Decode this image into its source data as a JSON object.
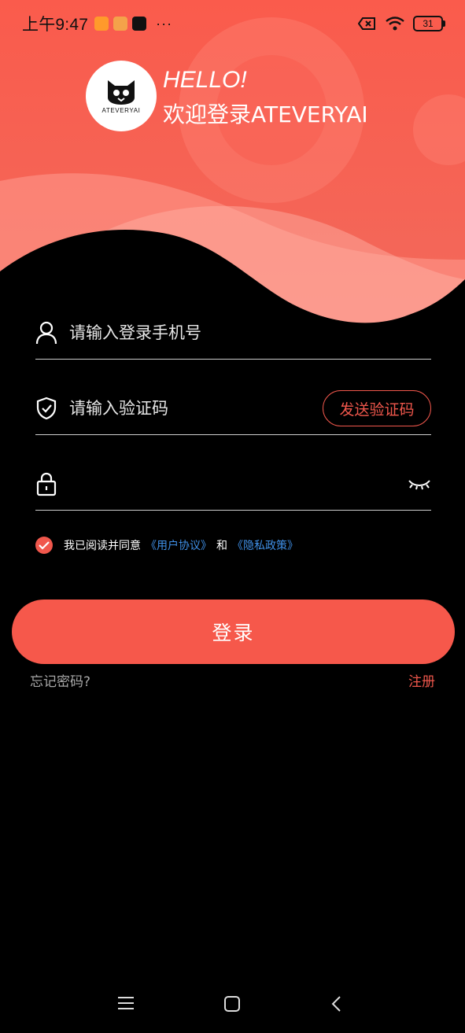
{
  "status_bar": {
    "time": "上午9:47",
    "dots": "···",
    "battery": "31"
  },
  "brand": {
    "logo_text": "ATEVERYAI",
    "hello": "HELLO!",
    "welcome": "欢迎登录ATEVERYAI"
  },
  "form": {
    "phone_placeholder": "请输入登录手机号",
    "phone_value": "",
    "code_placeholder": "请输入验证码",
    "code_value": "",
    "send_code_label": "发送验证码",
    "password_placeholder": "",
    "password_value": ""
  },
  "agreement": {
    "prefix": "我已阅读并同意",
    "user_agreement": "《用户协议》",
    "and": "和",
    "privacy_policy": "《隐私政策》",
    "checked": true
  },
  "actions": {
    "login": "登录",
    "forgot_password": "忘记密码?",
    "register": "注册"
  },
  "colors": {
    "accent": "#f6584b",
    "link": "#3f8fe6",
    "background": "#000000"
  },
  "icons": [
    "user-icon",
    "shield-check-icon",
    "lock-icon",
    "eye-closed-icon",
    "menu-icon",
    "home-icon",
    "back-icon"
  ]
}
